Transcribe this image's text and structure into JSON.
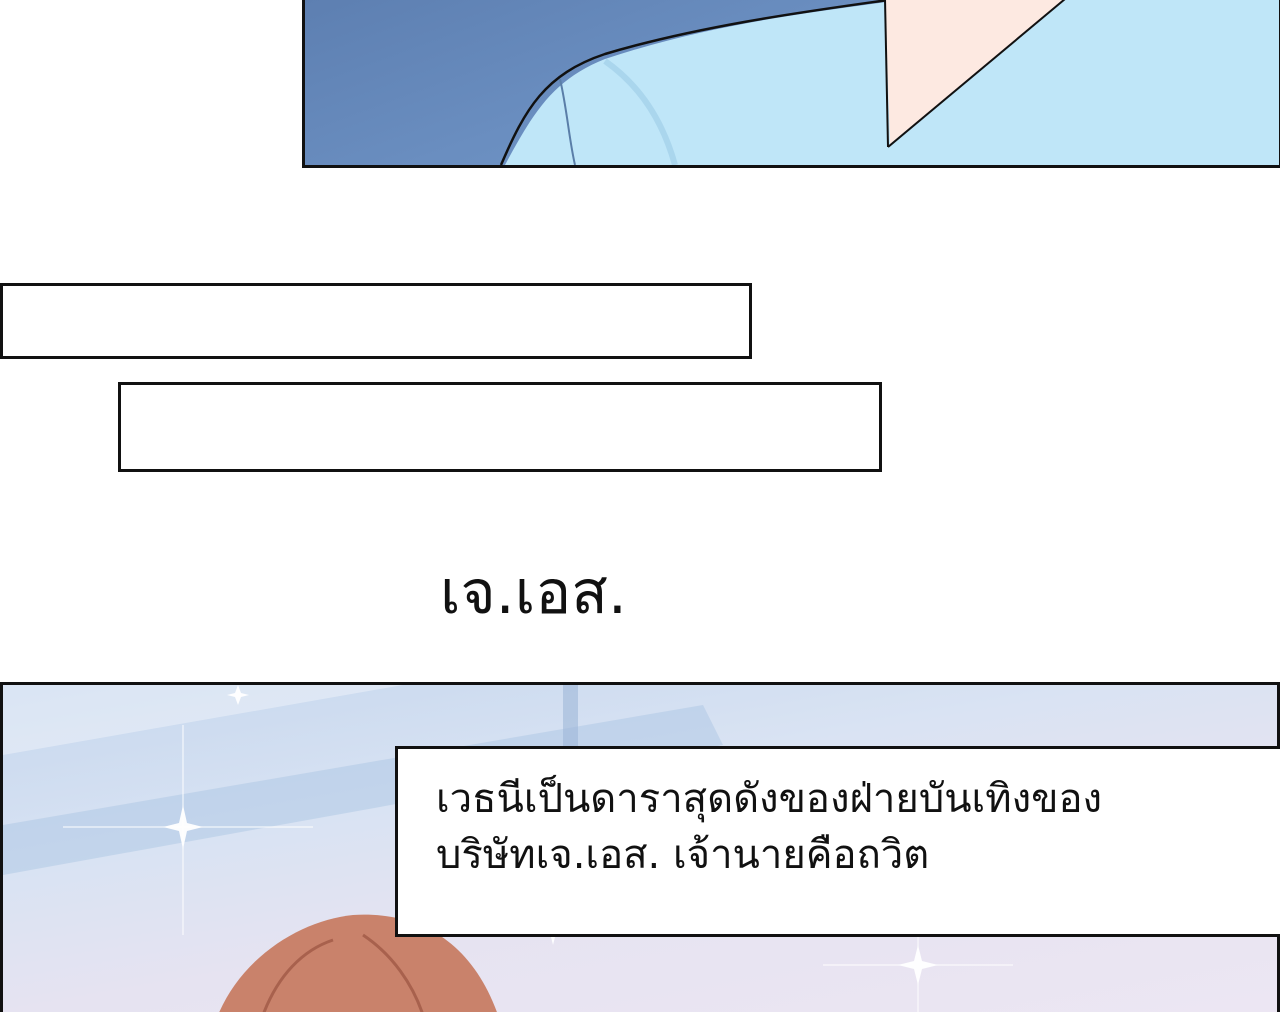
{
  "panels": {
    "top": {
      "description_icon": "character-collar-art"
    },
    "bottom": {
      "description_icon": "character-hair-sparkle-art"
    }
  },
  "title": {
    "text": "เจ.เอส."
  },
  "narration": {
    "lines": [
      "เวธนีเป็นดาราสุดดังของฝ่ายบันเทิงของ",
      "บริษัทเจ.เอส. เจ้านายคือถวิต"
    ]
  },
  "colors": {
    "shirt_blue": "#bfe6f8",
    "jacket_blue": "#6a8ec0",
    "skin": "#fde9e1",
    "hair": "#c9826b",
    "border": "#111111"
  }
}
